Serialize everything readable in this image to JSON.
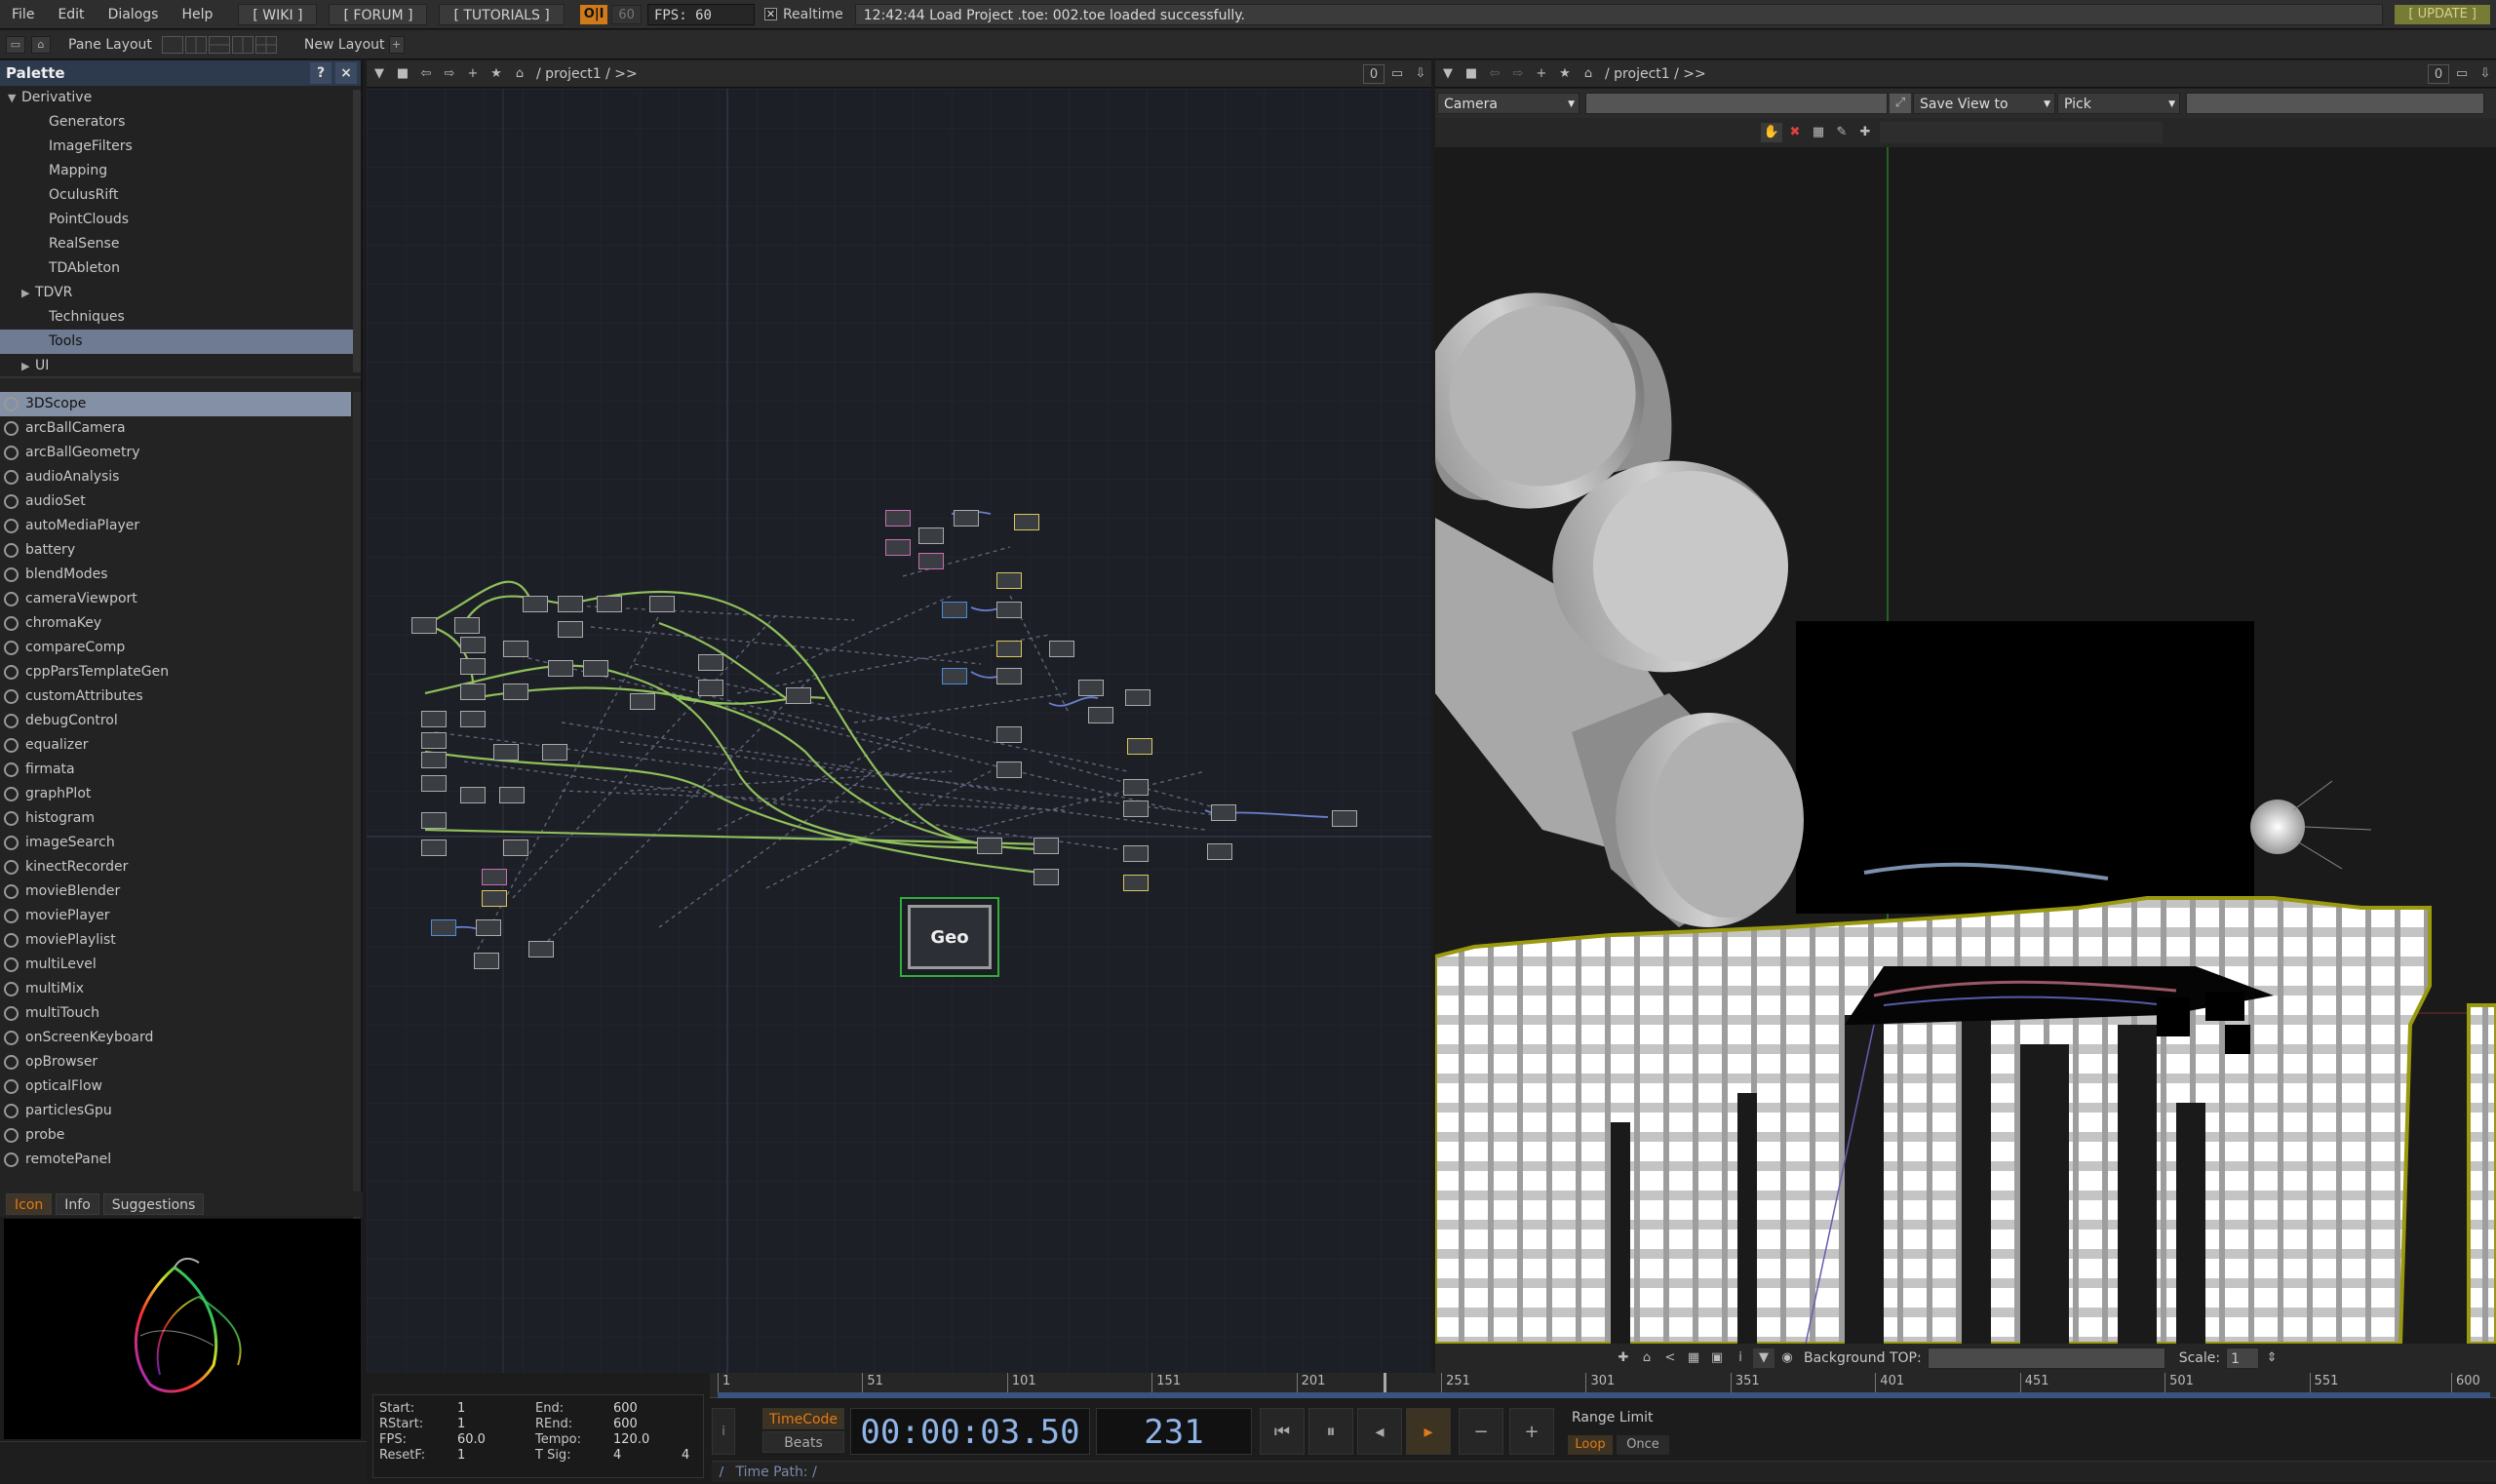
{
  "menubar": {
    "items": [
      "File",
      "Edit",
      "Dialogs",
      "Help"
    ],
    "links": [
      "[ WIKI ]",
      "[ FORUM ]",
      "[ TUTORIALS ]"
    ],
    "oi_label": "O|I",
    "fps_limit": "60",
    "fps_text": "FPS:  60",
    "realtime_label": "Realtime",
    "status": "12:42:44 Load Project .toe: 002.toe loaded successfully.",
    "update_label": "[ UPDATE ]"
  },
  "layoutbar": {
    "pane_layout": "Pane Layout",
    "new_layout": "New Layout",
    "plus": "+"
  },
  "palette": {
    "title": "Palette",
    "help": "?",
    "close": "×",
    "tree": [
      {
        "label": "Derivative",
        "indent": 0,
        "arrow": "▼"
      },
      {
        "label": "Generators",
        "indent": 2,
        "arrow": ""
      },
      {
        "label": "ImageFilters",
        "indent": 2,
        "arrow": ""
      },
      {
        "label": "Mapping",
        "indent": 2,
        "arrow": ""
      },
      {
        "label": "OculusRift",
        "indent": 2,
        "arrow": ""
      },
      {
        "label": "PointClouds",
        "indent": 2,
        "arrow": ""
      },
      {
        "label": "RealSense",
        "indent": 2,
        "arrow": ""
      },
      {
        "label": "TDAbleton",
        "indent": 2,
        "arrow": ""
      },
      {
        "label": "TDVR",
        "indent": 1,
        "arrow": "▶"
      },
      {
        "label": "Techniques",
        "indent": 2,
        "arrow": ""
      },
      {
        "label": "Tools",
        "indent": 2,
        "arrow": "",
        "selected": true
      },
      {
        "label": "UI",
        "indent": 1,
        "arrow": "▶"
      }
    ],
    "components": [
      "3DScope",
      "arcBallCamera",
      "arcBallGeometry",
      "audioAnalysis",
      "audioSet",
      "autoMediaPlayer",
      "battery",
      "blendModes",
      "cameraViewport",
      "chromaKey",
      "compareComp",
      "cppParsTemplateGen",
      "customAttributes",
      "debugControl",
      "equalizer",
      "firmata",
      "graphPlot",
      "histogram",
      "imageSearch",
      "kinectRecorder",
      "movieBlender",
      "moviePlayer",
      "moviePlaylist",
      "multiLevel",
      "multiMix",
      "multiTouch",
      "onScreenKeyboard",
      "opBrowser",
      "opticalFlow",
      "particlesGpu",
      "probe",
      "remotePanel"
    ],
    "selected_component": "3DScope",
    "tabs": [
      "Icon",
      "Info",
      "Suggestions"
    ],
    "active_tab": "Icon"
  },
  "network_pane": {
    "path": "/ project1  /  >>",
    "zero": "0",
    "geo_label": "Geo"
  },
  "viewer_pane": {
    "path": "/ project1  /  >>",
    "zero": "0",
    "camera_select": "Camera",
    "save_view_select": "Save View to",
    "pick_select": "Pick",
    "background_label": "Background TOP:",
    "scale_label": "Scale:",
    "scale_value": "1"
  },
  "timeline": {
    "ticks": [
      "1",
      "51",
      "101",
      "151",
      "201",
      "251",
      "301",
      "351",
      "401",
      "451",
      "501",
      "551",
      "600"
    ],
    "playhead_frame": 231,
    "range_end_frame": 600,
    "stats": {
      "start_label": "Start:",
      "start": "1",
      "end_label": "End:",
      "end": "600",
      "rstart_label": "RStart:",
      "rstart": "1",
      "rend_label": "REnd:",
      "rend": "600",
      "fps_label": "FPS:",
      "fps": "60.0",
      "tempo_label": "Tempo:",
      "tempo": "120.0",
      "resetf_label": "ResetF:",
      "resetf": "1",
      "tsig_label": "T Sig:",
      "tsig_a": "4",
      "tsig_b": "4"
    },
    "timecode_label": "TimeCode",
    "beats_label": "Beats",
    "timecode": "00:00:03.50",
    "frame": "231",
    "range_limit_label": "Range Limit",
    "loop_label": "Loop",
    "once_label": "Once",
    "time_path": "Time Path: /"
  },
  "colors": {
    "accent": "#e07a1a",
    "selection": "#8490a5",
    "wire_green": "#8fc05a",
    "wire_blue": "#6a7fd0",
    "timecode_blue": "#8fb4e8"
  }
}
